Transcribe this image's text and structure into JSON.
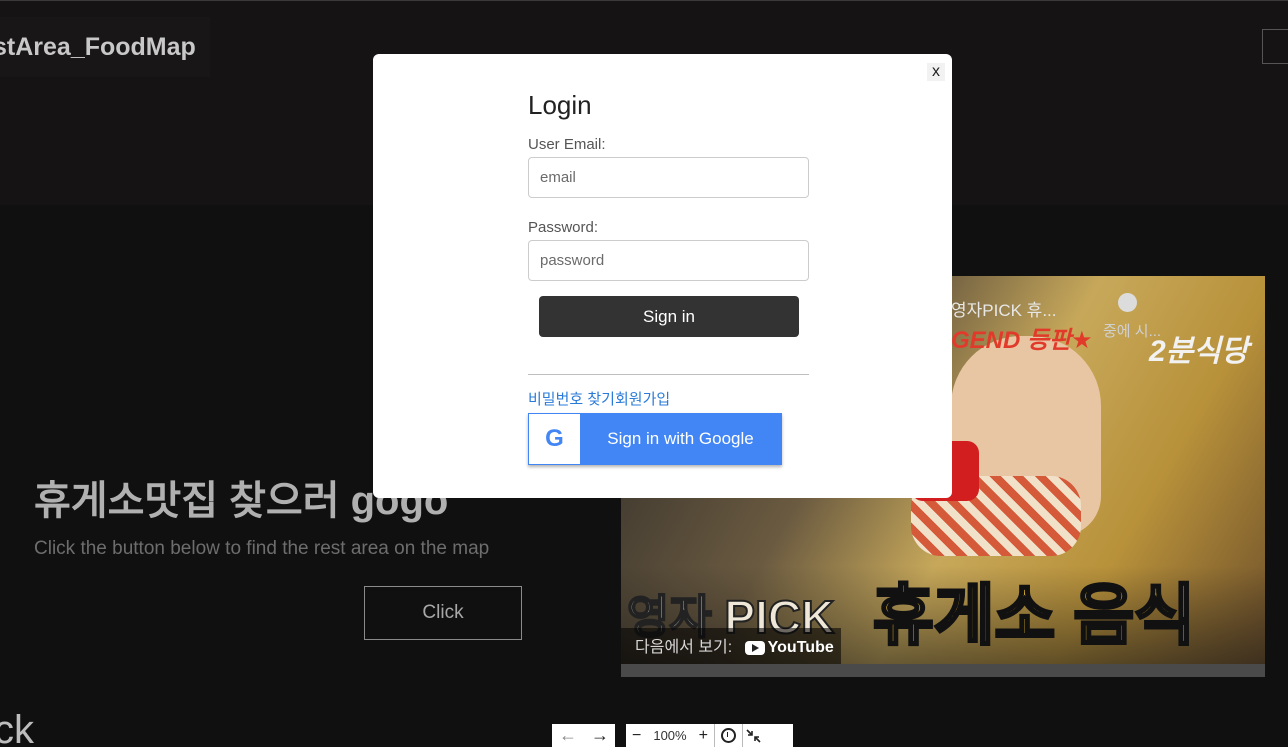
{
  "header": {
    "logo_text": "stArea_FoodMap"
  },
  "hero": {
    "title": "휴게소맛집 찾으러 gogo",
    "subtitle": "Click the button below to find the rest area on the map",
    "button_label": "Click"
  },
  "footer": {
    "partial_text": "ck"
  },
  "video": {
    "title": "영자PICK 휴...",
    "legend_text": "GEND 등판★",
    "watch_later": "중에 시...",
    "channel_text": "2분식당",
    "caption_left": "영자 PICK",
    "caption_right": "휴게소 음식",
    "watch_on": "다음에서 보기:",
    "platform": "YouTube"
  },
  "toolbar": {
    "back": "←",
    "forward": "→",
    "zoom_out": "−",
    "zoom_level": "100%",
    "zoom_in": "+"
  },
  "login": {
    "close": "x",
    "title": "Login",
    "email_label": "User Email:",
    "email_placeholder": "email",
    "password_label": "Password:",
    "password_placeholder": "password",
    "signin": "Sign in",
    "find_password": "비밀번호 찾기",
    "signup": "회원가입",
    "google_signin": "Sign in with Google",
    "google_letter": "G"
  }
}
